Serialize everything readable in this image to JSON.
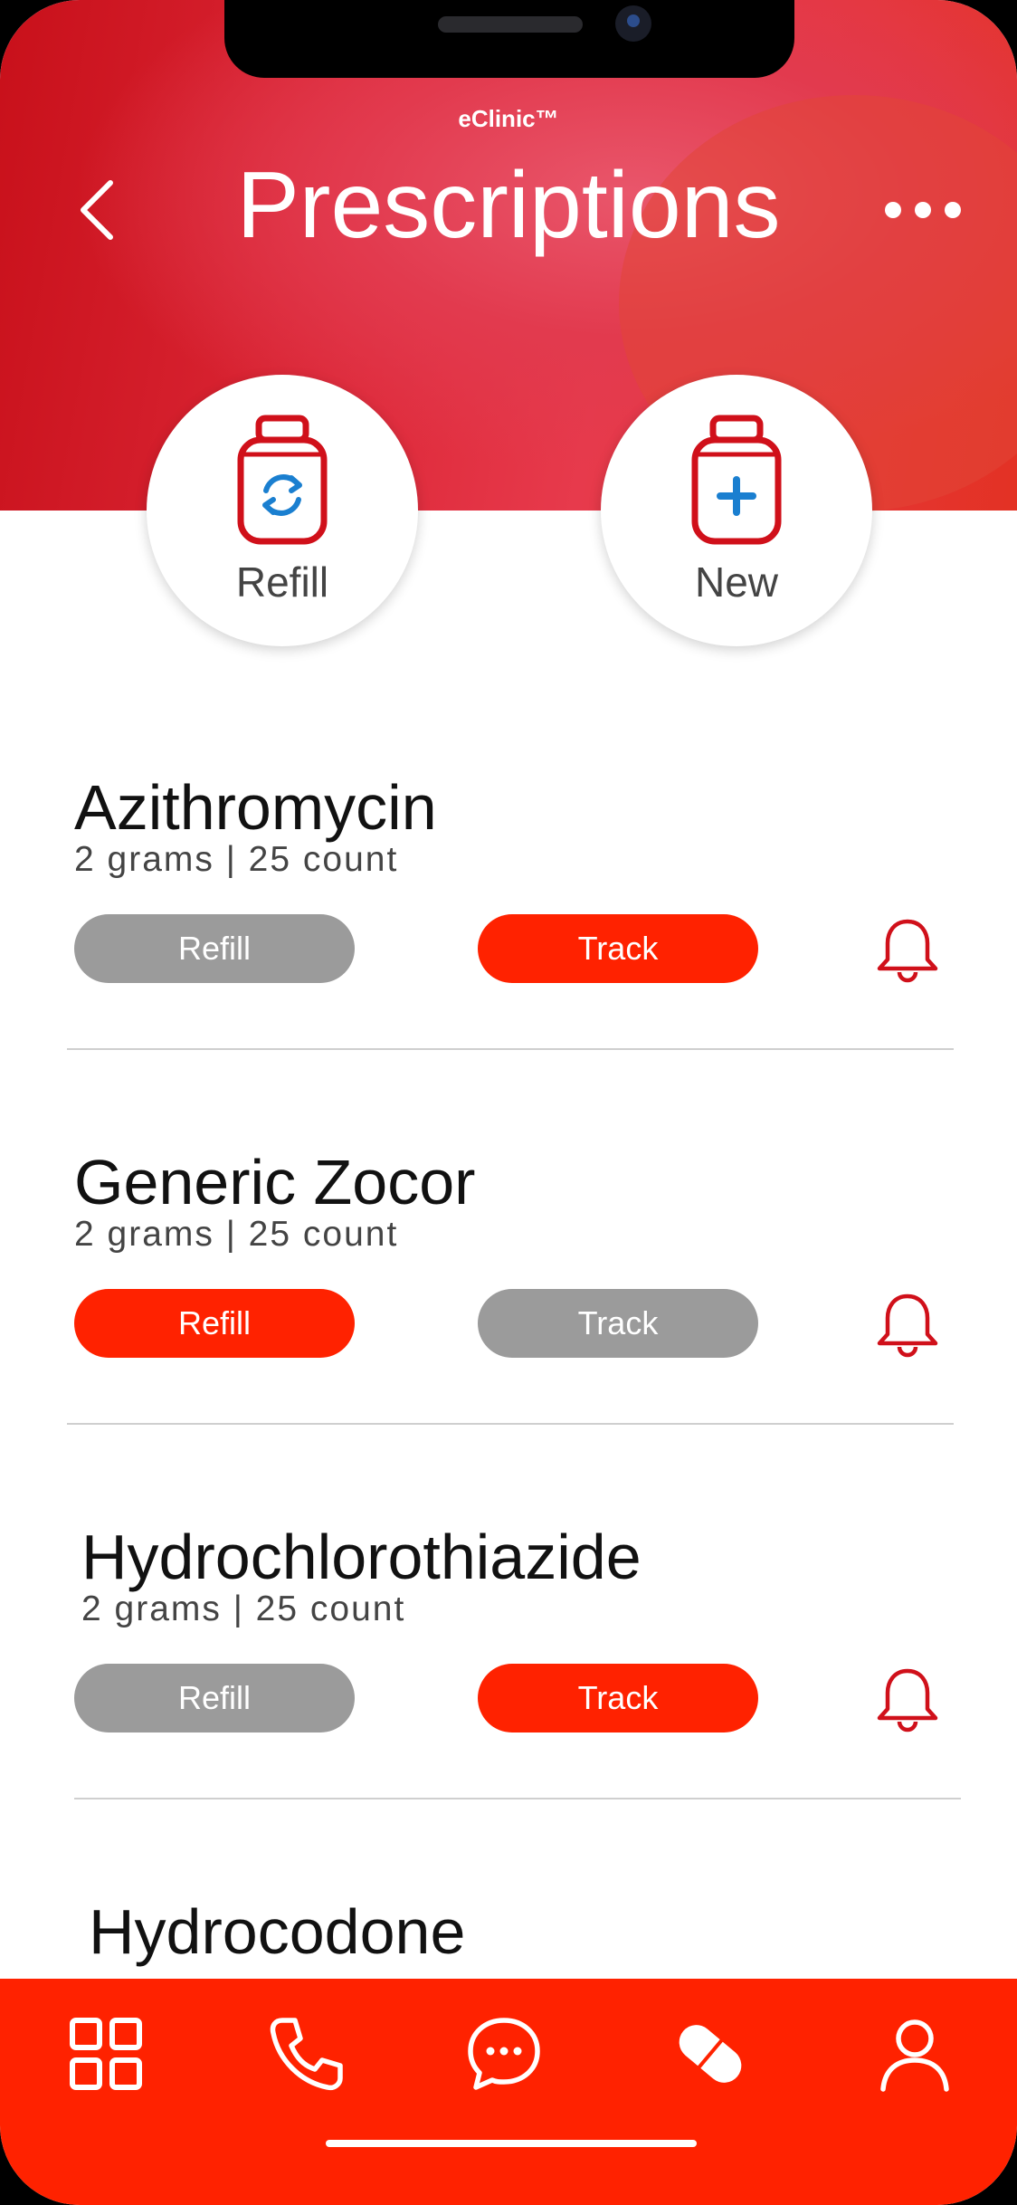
{
  "app": {
    "brand": "eClinic™",
    "title": "Prescriptions"
  },
  "colors": {
    "accent_red": "#ff2200",
    "icon_red": "#d0101a",
    "icon_blue": "#1a7fd0",
    "inactive_gray": "#9b9b9b"
  },
  "header": {
    "back_icon": "chevron-left-icon",
    "more_icon": "more-horizontal-icon"
  },
  "actions": [
    {
      "label": "Refill",
      "icon": "refill-bottle-icon"
    },
    {
      "label": "New",
      "icon": "new-bottle-icon"
    }
  ],
  "prescriptions": [
    {
      "name": "Azithromycin",
      "detail": "2 grams | 25 count",
      "refill_label": "Refill",
      "track_label": "Track",
      "active": "track"
    },
    {
      "name": "Generic Zocor",
      "detail": "2 grams | 25 count",
      "refill_label": "Refill",
      "track_label": "Track",
      "active": "refill"
    },
    {
      "name": "Hydrochlorothiazide",
      "detail": "2 grams | 25 count",
      "refill_label": "Refill",
      "track_label": "Track",
      "active": "track"
    },
    {
      "name": "Hydrocodone"
    }
  ],
  "nav": [
    {
      "icon": "grid-icon"
    },
    {
      "icon": "phone-icon"
    },
    {
      "icon": "chat-icon"
    },
    {
      "icon": "pill-icon",
      "active": true
    },
    {
      "icon": "user-icon"
    }
  ]
}
